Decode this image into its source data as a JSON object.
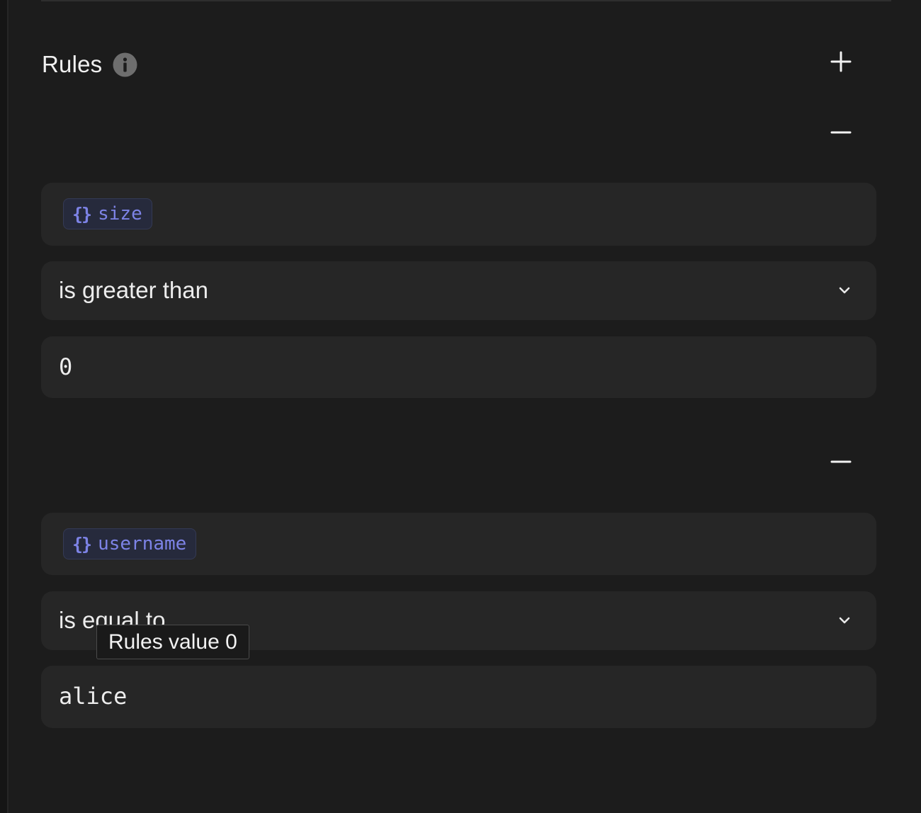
{
  "rules": {
    "title": "Rules",
    "info_icon": "info-icon",
    "add_icon": "plus-icon",
    "remove_icon": "minus-icon",
    "items": [
      {
        "variable_icon": "braces-icon",
        "variable_braces": "{}",
        "variable": "size",
        "operator": "is greater than",
        "value": "0"
      },
      {
        "variable_icon": "braces-icon",
        "variable_braces": "{}",
        "variable": "username",
        "operator": "is equal to",
        "value": "alice"
      }
    ]
  },
  "tooltip": {
    "text": "Rules value 0"
  },
  "colors": {
    "background": "#1c1c1c",
    "field": "#262626",
    "variable_accent": "#7d83e6",
    "variable_chip_bg": "#262a3c",
    "text": "#ededed"
  }
}
